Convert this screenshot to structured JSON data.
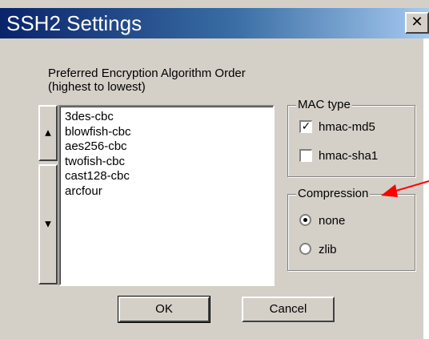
{
  "window": {
    "title": "SSH2 Settings",
    "close_glyph": "✕"
  },
  "encryption": {
    "label_line1": "Preferred Encryption Algorithm Order",
    "label_line2": "(highest to lowest)",
    "items": [
      "3des-cbc",
      "blowfish-cbc",
      "aes256-cbc",
      "twofish-cbc",
      "cast128-cbc",
      "arcfour"
    ],
    "move_up_icon": "▲",
    "move_down_icon": "▼"
  },
  "mac_type": {
    "legend": "MAC type",
    "options": [
      {
        "label": "hmac-md5",
        "checked": true,
        "mark": "✓"
      },
      {
        "label": "hmac-sha1",
        "checked": false,
        "mark": ""
      }
    ]
  },
  "compression": {
    "legend": "Compression",
    "options": [
      {
        "label": "none",
        "selected": true
      },
      {
        "label": "zlib",
        "selected": false
      }
    ]
  },
  "buttons": {
    "ok": "OK",
    "cancel": "Cancel"
  },
  "annotation": {
    "arrow_color": "#ff0000",
    "arrow_icon": "red-arrow-icon"
  },
  "colors": {
    "dialog_bg": "#d4d0c8",
    "title_start": "#0a246a",
    "title_end": "#a6caf0"
  }
}
